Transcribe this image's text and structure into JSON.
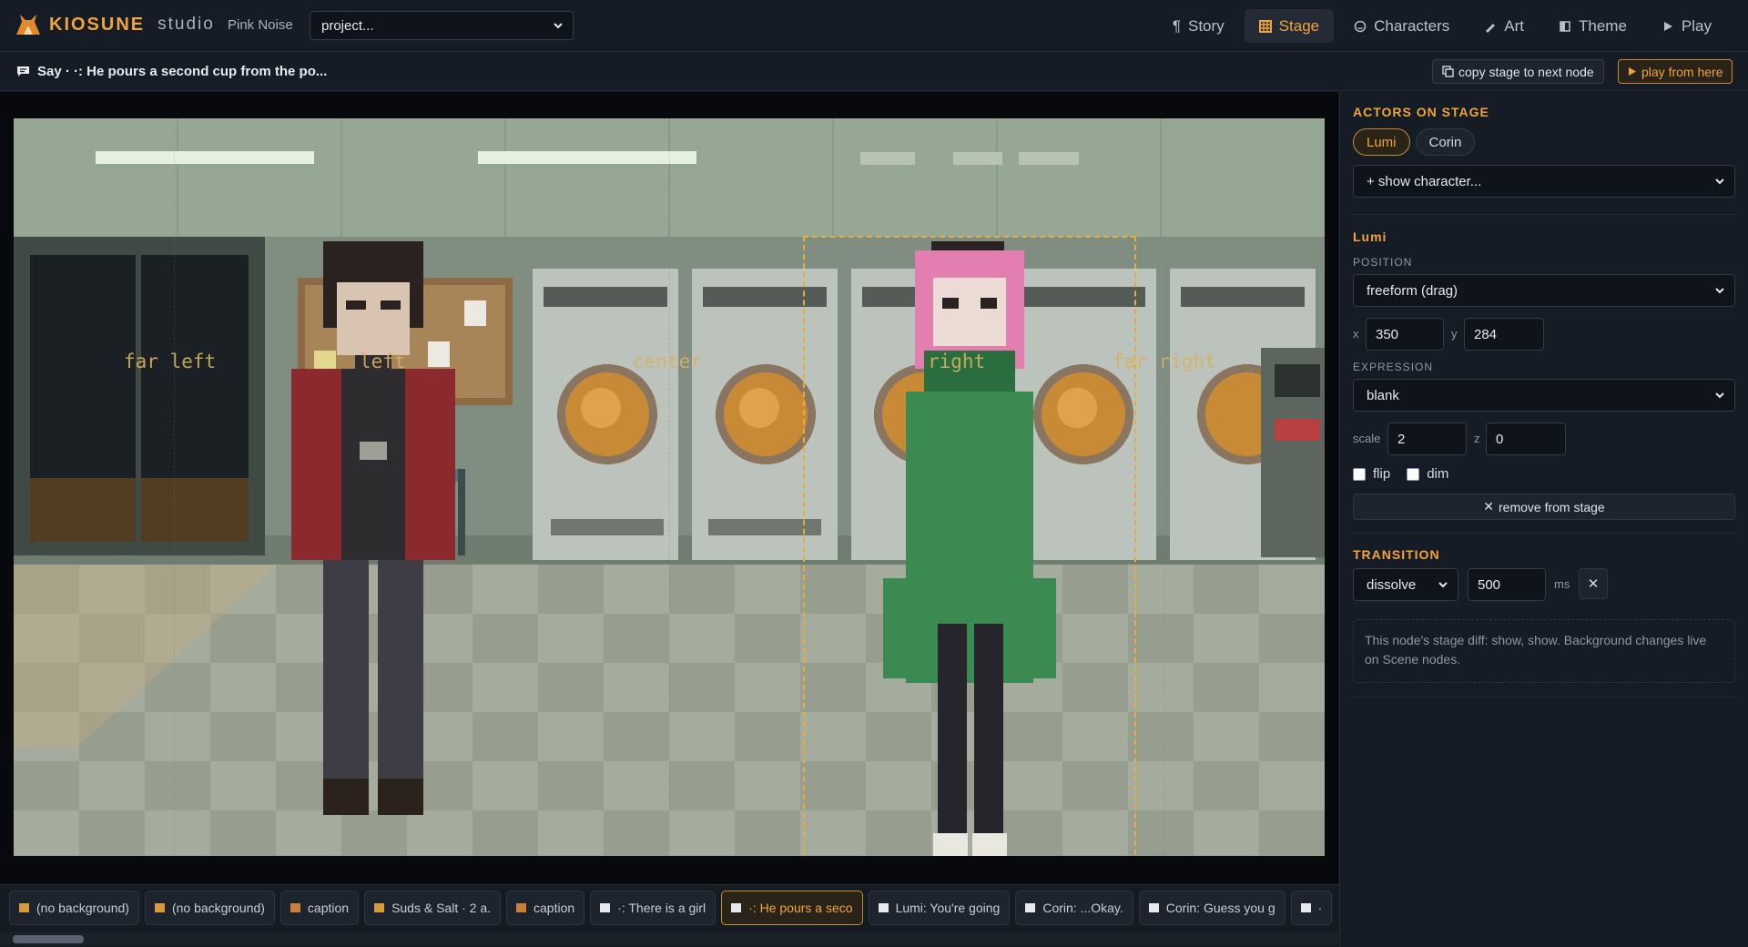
{
  "app": {
    "brand": "KIOSUNE",
    "brand_sub": "studio",
    "project_name": "Pink Noise",
    "project_select": "project...",
    "accent": "#f1a43a"
  },
  "nav": [
    {
      "label": "Story",
      "icon": "paragraph-icon"
    },
    {
      "label": "Stage",
      "icon": "grid-icon",
      "active": true
    },
    {
      "label": "Characters",
      "icon": "smiley-icon"
    },
    {
      "label": "Art",
      "icon": "brush-icon"
    },
    {
      "label": "Theme",
      "icon": "theme-icon"
    },
    {
      "label": "Play",
      "icon": "play-icon"
    }
  ],
  "node": {
    "title": "Say · ·: He pours a second cup from the po...",
    "copy_label": "copy stage to next node",
    "play_label": "play from here"
  },
  "stage": {
    "slots": [
      "far left",
      "left",
      "center",
      "right",
      "far right"
    ]
  },
  "panel": {
    "actors_title": "ACTORS ON STAGE",
    "actors": [
      "Lumi",
      "Corin"
    ],
    "show_character": "+ show character...",
    "selected_name": "Lumi",
    "position_label": "POSITION",
    "position_value": "freeform (drag)",
    "x_label": "x",
    "x_value": "350",
    "y_label": "y",
    "y_value": "284",
    "expression_label": "EXPRESSION",
    "expression_value": "blank",
    "scale_label": "scale",
    "scale_value": "2",
    "z_label": "z",
    "z_value": "0",
    "flip_label": "flip",
    "dim_label": "dim",
    "remove_label": "remove from stage",
    "transition_title": "TRANSITION",
    "transition_value": "dissolve",
    "ms_value": "500",
    "ms_label": "ms",
    "note": "This node's stage diff: show, show. Background changes live on Scene nodes."
  },
  "timeline": [
    {
      "label": "(no background)",
      "icon": "scene-icon"
    },
    {
      "label": "(no background)",
      "icon": "scene-icon"
    },
    {
      "label": "caption",
      "icon": "caption-icon"
    },
    {
      "label": "Suds & Salt · 2 a.",
      "icon": "scene-icon"
    },
    {
      "label": "caption",
      "icon": "caption-icon"
    },
    {
      "label": "·: There is a girl",
      "icon": "say-icon"
    },
    {
      "label": "·: He pours a seco",
      "icon": "say-icon",
      "active": true
    },
    {
      "label": "Lumi: You're going",
      "icon": "say-icon"
    },
    {
      "label": "Corin: ...Okay.",
      "icon": "say-icon"
    },
    {
      "label": "Corin: Guess you g",
      "icon": "say-icon"
    },
    {
      "label": "·",
      "icon": "say-icon"
    }
  ]
}
